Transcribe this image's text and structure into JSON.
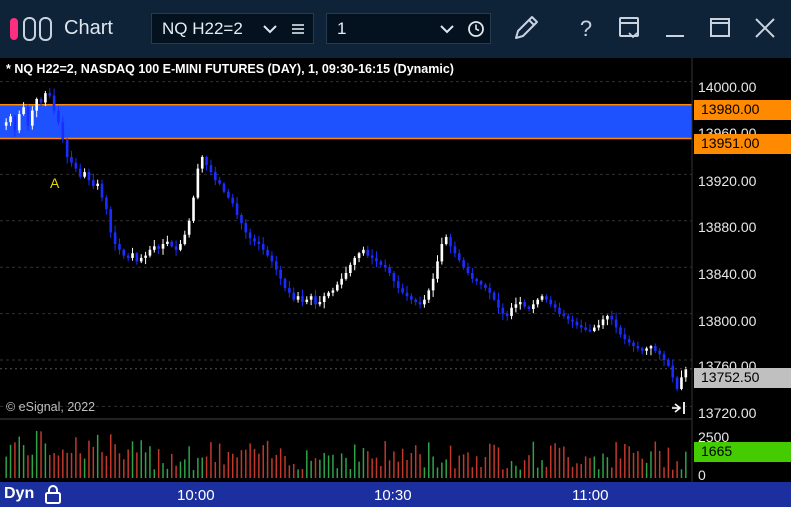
{
  "window": {
    "title": "Chart",
    "symbol": "NQ H22=2",
    "interval": "1"
  },
  "chart": {
    "title": "* NQ H22=2, NASDAQ 100 E-MINI FUTURES (DAY), 1, 09:30-16:15 (Dynamic)",
    "copyright": "© eSignal, 2022",
    "marker": "A",
    "price_axis": [
      "14000.00",
      "13960.00",
      "13920.00",
      "13880.00",
      "13840.00",
      "13800.00",
      "13760.00",
      "13720.00"
    ],
    "tags": {
      "upper": "13980.00",
      "lower": "13951.00",
      "last": "13752.50",
      "volume": "1665"
    },
    "volume_axis": [
      "2500",
      "0"
    ],
    "time_axis": [
      "10:00",
      "10:30",
      "11:00"
    ],
    "mode": "Dyn",
    "colors": {
      "band": "#1f52ff",
      "band_border": "#ff8a00",
      "up_candle": "#ffffff",
      "down_candle": "#1b2cff",
      "vol_up": "#2fa24a",
      "vol_down": "#c0392b"
    }
  },
  "chart_data": {
    "type": "candlestick",
    "title": "* NQ H22=2, NASDAQ 100 E-MINI FUTURES (DAY), 1, 09:30-16:15 (Dynamic)",
    "ylim": [
      13710,
      14010
    ],
    "y_ticks": [
      14000,
      13960,
      13920,
      13880,
      13840,
      13800,
      13760,
      13720
    ],
    "x_ticks": [
      "10:00",
      "10:30",
      "11:00"
    ],
    "band": [
      13951,
      13980
    ],
    "last": 13752.5,
    "volume_last": 1665,
    "volume_ticks": [
      2500,
      0
    ],
    "closes": [
      13965,
      13970,
      13958,
      13972,
      13978,
      13962,
      13975,
      13985,
      13982,
      13990,
      13988,
      13975,
      13965,
      13950,
      13935,
      13930,
      13925,
      13918,
      13922,
      13915,
      13910,
      13912,
      13900,
      13890,
      13870,
      13860,
      13855,
      13850,
      13848,
      13852,
      13845,
      13848,
      13850,
      13855,
      13858,
      13856,
      13860,
      13862,
      13858,
      13855,
      13860,
      13868,
      13880,
      13900,
      13925,
      13935,
      13928,
      13922,
      13915,
      13912,
      13905,
      13900,
      13895,
      13885,
      13878,
      13870,
      13865,
      13862,
      13860,
      13855,
      13850,
      13845,
      13838,
      13830,
      13822,
      13818,
      13812,
      13815,
      13810,
      13812,
      13815,
      13808,
      13810,
      13815,
      13818,
      13820,
      13825,
      13830,
      13835,
      13842,
      13848,
      13852,
      13855,
      13850,
      13848,
      13845,
      13842,
      13840,
      13835,
      13828,
      13822,
      13818,
      13815,
      13812,
      13810,
      13808,
      13812,
      13820,
      13830,
      13845,
      13860,
      13866,
      13858,
      13852,
      13846,
      13840,
      13835,
      13830,
      13828,
      13825,
      13822,
      13818,
      13812,
      13805,
      13800,
      13798,
      13805,
      13808,
      13810,
      13806,
      13804,
      13808,
      13812,
      13815,
      13812,
      13808,
      13805,
      13800,
      13798,
      13795,
      13793,
      13790,
      13788,
      13786,
      13785,
      13788,
      13790,
      13795,
      13798,
      13795,
      13788,
      13782,
      13778,
      13775,
      13772,
      13770,
      13768,
      13770,
      13772,
      13768,
      13765,
      13760,
      13755,
      13745,
      13735,
      13745,
      13752
    ]
  }
}
